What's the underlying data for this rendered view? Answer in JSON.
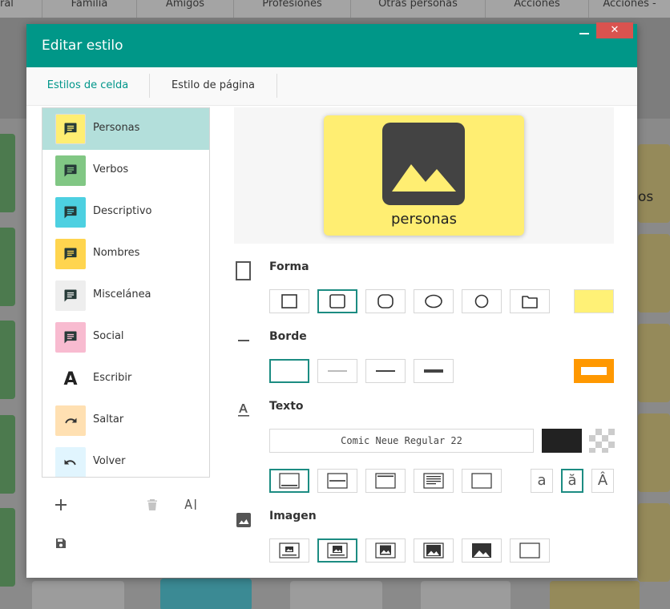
{
  "background": {
    "nav_tabs": [
      "ral",
      "Familia",
      "Amigos",
      "Profesiones",
      "Otras personas",
      "Acciones",
      "Acciones -"
    ],
    "cell_text": "os"
  },
  "dialog": {
    "title": "Editar estilo",
    "close_label": "✕",
    "tabs": [
      {
        "label": "Estilos de celda",
        "active": true
      },
      {
        "label": "Estilo de página",
        "active": false
      }
    ]
  },
  "styles": [
    {
      "label": "Personas",
      "color": "#ffee72",
      "icon": "comment-icon",
      "selected": true
    },
    {
      "label": "Verbos",
      "color": "#81c784",
      "icon": "comment-icon"
    },
    {
      "label": "Descriptivo",
      "color": "#4dd0e1",
      "icon": "comment-icon"
    },
    {
      "label": "Nombres",
      "color": "#ffd54f",
      "icon": "comment-icon"
    },
    {
      "label": "Miscelánea",
      "color": "#eeeeee",
      "icon": "comment-icon"
    },
    {
      "label": "Social",
      "color": "#f8bbd0",
      "icon": "comment-icon"
    },
    {
      "label": "Escribir",
      "color": "#ffffff",
      "icon": "letter-a-icon",
      "glyph": "A"
    },
    {
      "label": "Saltar",
      "color": "#ffe0b2",
      "icon": "redo-icon"
    },
    {
      "label": "Volver",
      "color": "#e1f5fe",
      "icon": "undo-icon"
    }
  ],
  "preview": {
    "label": "personas",
    "background": "#ffee72"
  },
  "sections": {
    "forma": "Forma",
    "borde": "Borde",
    "texto": "Texto",
    "imagen": "Imagen"
  },
  "shape": {
    "selected_index": 1,
    "fill_color": "#fff176"
  },
  "border": {
    "selected_index": 0,
    "color": "#ff9800"
  },
  "text": {
    "font": "Comic Neue Regular 22",
    "color": "#222222",
    "position_selected_index": 0,
    "case_options": [
      "a",
      "ă",
      "Â"
    ],
    "case_selected_index": 1
  },
  "image": {
    "selected_index": 1
  }
}
